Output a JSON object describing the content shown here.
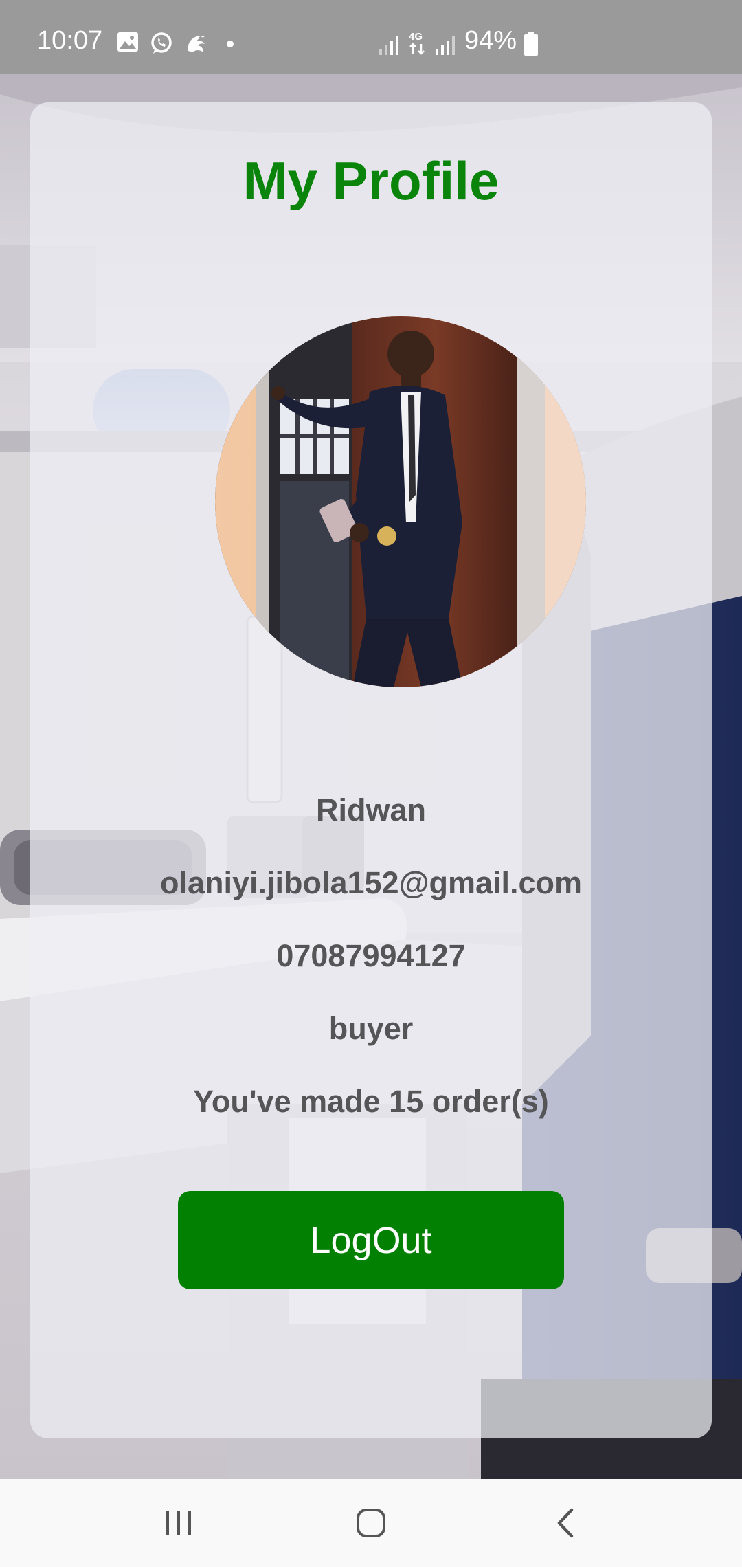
{
  "status_bar": {
    "time": "10:07",
    "battery_percent": "94%",
    "icons": [
      "gallery-icon",
      "whatsapp-icon",
      "browser-icon",
      "notification-dot",
      "signal-icon",
      "4g-data-icon",
      "signal-icon",
      "battery-icon"
    ]
  },
  "profile": {
    "title": "My Profile",
    "name": "Ridwan",
    "email": "olaniyi.jibola152@gmail.com",
    "phone": "07087994127",
    "role": "buyer",
    "orders_text": "You've made 15 order(s)",
    "logout_label": "LogOut"
  },
  "nav_bar": {
    "icons": [
      "recent-apps-icon",
      "home-icon",
      "back-icon"
    ]
  },
  "colors": {
    "title_green": "#0a840a",
    "button_green": "#028002",
    "info_text": "#555558",
    "status_bar": "#9a9a9a",
    "nav_bar": "#f9f9f9"
  }
}
